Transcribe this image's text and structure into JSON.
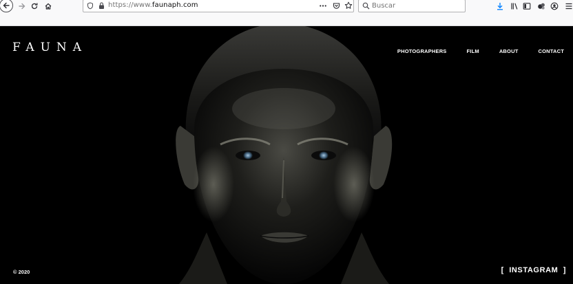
{
  "browser": {
    "url_prefix": "https://www.",
    "url_domain": "faunaph.com",
    "search_placeholder": "Buscar",
    "icons": [
      "back-icon",
      "forward-icon",
      "reload-icon",
      "home-icon",
      "shield-icon",
      "lock-icon",
      "more-icon",
      "pocket-icon",
      "star-icon",
      "search-icon",
      "download-icon",
      "library-icon",
      "sidebar-icon",
      "extensions-icon",
      "account-icon",
      "menu-icon"
    ],
    "accent_color": "#0a84ff"
  },
  "site": {
    "logo": "FAUNA",
    "nav": [
      "PHOTOGRAPHERS",
      "FILM",
      "ABOUT",
      "CONTACT"
    ],
    "copyright": "© 2020",
    "instagram": "[  INSTAGRAM  ]",
    "hero_alt": "",
    "background_color": "#000000"
  }
}
